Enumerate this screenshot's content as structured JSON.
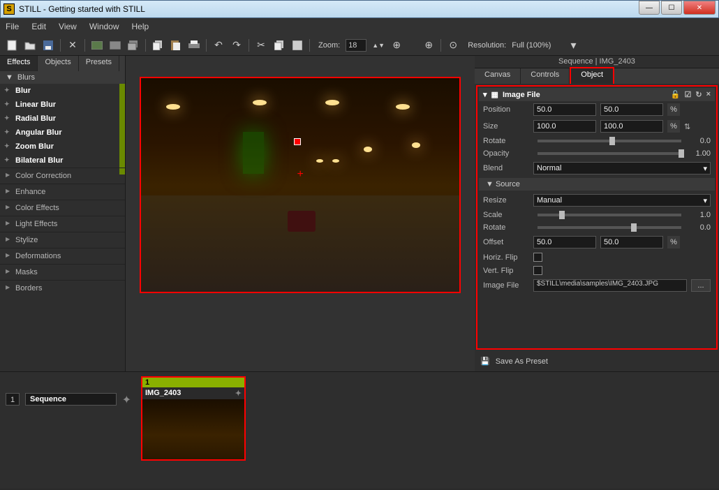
{
  "window": {
    "title": "STILL - Getting started with STILL",
    "appicon_letter": "S"
  },
  "menu": [
    "File",
    "Edit",
    "View",
    "Window",
    "Help"
  ],
  "toolbar": {
    "zoom_label": "Zoom:",
    "zoom_value": "18",
    "resolution_label": "Resolution:",
    "resolution_value": "Full (100%)"
  },
  "left_tabs": [
    "Effects",
    "Objects",
    "Presets"
  ],
  "left_active_category": "Blurs",
  "effects": [
    "Blur",
    "Linear Blur",
    "Radial Blur",
    "Angular Blur",
    "Zoom Blur",
    "Bilateral Blur"
  ],
  "categories": [
    "Color Correction",
    "Enhance",
    "Color Effects",
    "Light Effects",
    "Stylize",
    "Deformations",
    "Masks",
    "Borders"
  ],
  "right_header": "Sequence | IMG_2403",
  "right_tabs": [
    "Canvas",
    "Controls",
    "Object"
  ],
  "prop_title": "Image File",
  "props": {
    "position_label": "Position",
    "position_x": "50.0",
    "position_y": "50.0",
    "size_label": "Size",
    "size_x": "100.0",
    "size_y": "100.0",
    "rotate_label": "Rotate",
    "rotate_val": "0.0",
    "opacity_label": "Opacity",
    "opacity_val": "1.00",
    "blend_label": "Blend",
    "blend_val": "Normal",
    "source_label": "Source",
    "resize_label": "Resize",
    "resize_val": "Manual",
    "scale_label": "Scale",
    "scale_val": "1.0",
    "rotate2_label": "Rotate",
    "rotate2_val": "0.0",
    "offset_label": "Offset",
    "offset_x": "50.0",
    "offset_y": "50.0",
    "hflip_label": "Horiz. Flip",
    "vflip_label": "Vert. Flip",
    "file_label": "Image File",
    "file_path": "$STILL\\media\\samples\\IMG_2403.JPG",
    "pct": "%"
  },
  "save_preset": "Save As Preset",
  "sequence": {
    "num": "1",
    "label": "Sequence"
  },
  "thumb": {
    "num": "1",
    "name": "IMG_2403"
  }
}
